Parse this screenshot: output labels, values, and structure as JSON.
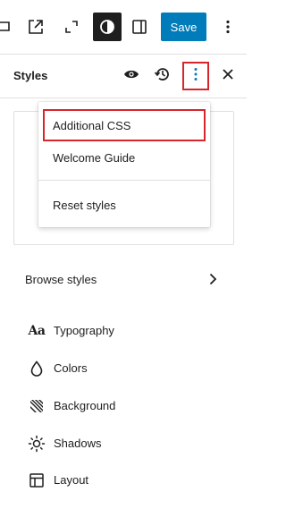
{
  "toolbar": {
    "icons": [
      "block-partial-icon",
      "external-link-icon",
      "fullscreen-icon",
      "contrast-icon",
      "sidebar-toggle-icon",
      "more-options-icon"
    ],
    "save_label": "Save",
    "colors": {
      "primary": "#007cba",
      "dark": "#1e1e1e",
      "highlight": "#d6262c"
    }
  },
  "panel": {
    "title": "Styles",
    "header_icons": [
      "eye-icon",
      "revisions-icon",
      "more-vertical-icon",
      "close-icon"
    ]
  },
  "menu": {
    "items": [
      {
        "label": "Additional CSS"
      },
      {
        "label": "Welcome Guide"
      },
      {
        "label": "Reset styles"
      }
    ]
  },
  "browse": {
    "label": "Browse styles"
  },
  "nav": {
    "items": [
      {
        "label": "Typography",
        "icon": "typography-icon",
        "glyph": "Aa"
      },
      {
        "label": "Colors",
        "icon": "droplet-icon"
      },
      {
        "label": "Background",
        "icon": "background-icon"
      },
      {
        "label": "Shadows",
        "icon": "shadow-icon"
      },
      {
        "label": "Layout",
        "icon": "layout-icon"
      }
    ]
  }
}
